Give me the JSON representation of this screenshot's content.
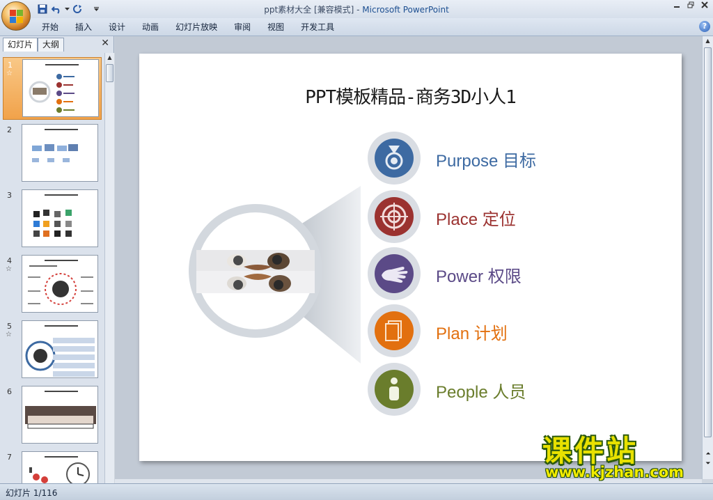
{
  "window": {
    "title_doc": "ppt素材大全 [兼容模式]",
    "title_sep": " - ",
    "title_app": "Microsoft PowerPoint"
  },
  "ribbon": {
    "tabs": [
      "开始",
      "插入",
      "设计",
      "动画",
      "幻灯片放映",
      "审阅",
      "视图",
      "开发工具"
    ],
    "help": "?"
  },
  "left_pane": {
    "tabs": [
      "幻灯片",
      "大纲"
    ],
    "close": "✕",
    "thumbnails": [
      {
        "num": "1",
        "star": "☆"
      },
      {
        "num": "2",
        "star": ""
      },
      {
        "num": "3",
        "star": ""
      },
      {
        "num": "4",
        "star": "☆"
      },
      {
        "num": "5",
        "star": "☆"
      },
      {
        "num": "6",
        "star": ""
      },
      {
        "num": "7",
        "star": ""
      }
    ],
    "selected_index": 0
  },
  "slide": {
    "title": "PPT模板精品-商务3D小人1",
    "items": [
      {
        "label": "Purpose 目标",
        "color": "#3d6aa2",
        "icon": "medal-icon"
      },
      {
        "label": "Place 定位",
        "color": "#9b3230",
        "icon": "target-icon"
      },
      {
        "label": "Power 权限",
        "color": "#5b4a87",
        "icon": "hand-icon"
      },
      {
        "label": "Plan 计划",
        "color": "#e2700f",
        "icon": "document-icon"
      },
      {
        "label": "People 人员",
        "color": "#6a7d2c",
        "icon": "person-icon"
      }
    ]
  },
  "status": {
    "slide_counter": "幻灯片 1/116"
  },
  "watermark": {
    "title": "课件站",
    "url": "www.kjzhan.com"
  }
}
